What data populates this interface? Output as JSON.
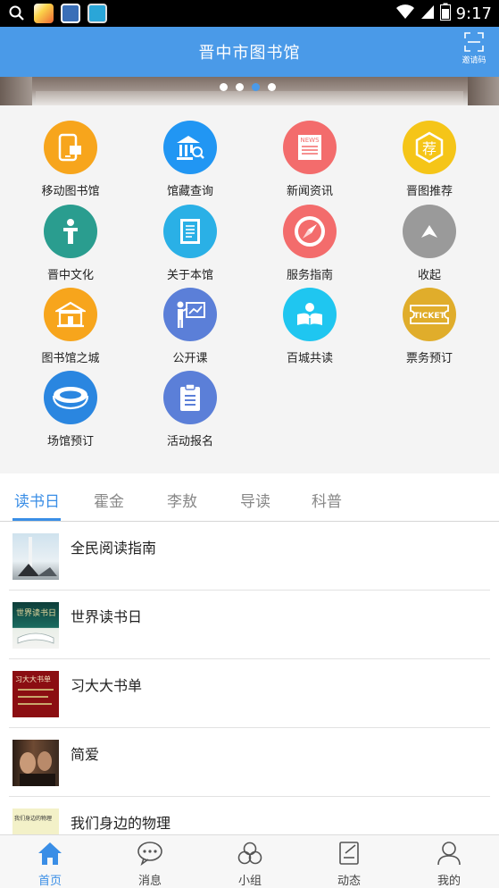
{
  "statusbar": {
    "time": "9:17"
  },
  "header": {
    "title": "晋中市图书馆",
    "invite_label": "邀请码"
  },
  "banner": {
    "slide_count": 4,
    "active_index": 2
  },
  "grid": [
    {
      "label": "移动图书馆",
      "icon": "mobile-library-icon",
      "color": "#f7a51c"
    },
    {
      "label": "馆藏查询",
      "icon": "collection-search-icon",
      "color": "#2196f3"
    },
    {
      "label": "新闻资讯",
      "icon": "news-icon",
      "color": "#f36c6c"
    },
    {
      "label": "晋图推荐",
      "icon": "recommend-icon",
      "color": "#f5c518"
    },
    {
      "label": "晋中文化",
      "icon": "culture-icon",
      "color": "#2a9d8f"
    },
    {
      "label": "关于本馆",
      "icon": "about-icon",
      "color": "#2ab0e6"
    },
    {
      "label": "服务指南",
      "icon": "compass-icon",
      "color": "#f36c6c"
    },
    {
      "label": "收起",
      "icon": "collapse-icon",
      "color": "#9a9a9a"
    },
    {
      "label": "图书馆之城",
      "icon": "library-city-icon",
      "color": "#f7a51c"
    },
    {
      "label": "公开课",
      "icon": "open-course-icon",
      "color": "#5b7fd8"
    },
    {
      "label": "百城共读",
      "icon": "reading-icon",
      "color": "#1fc6f0"
    },
    {
      "label": "票务预订",
      "icon": "ticket-icon",
      "color": "#e0ad2b"
    },
    {
      "label": "场馆预订",
      "icon": "venue-icon",
      "color": "#2a86e0"
    },
    {
      "label": "活动报名",
      "icon": "signup-icon",
      "color": "#5b7fd8"
    }
  ],
  "ticket_text": "TICKET",
  "recommend_char": "荐",
  "news_text": "NEWS",
  "tabs": [
    "读书日",
    "霍金",
    "李敖",
    "导读",
    "科普"
  ],
  "active_tab": 0,
  "list": [
    {
      "title": "全民阅读指南"
    },
    {
      "title": "世界读书日",
      "thumb_text": "世界读书日"
    },
    {
      "title": "习大大书单",
      "thumb_text": "习大大书单"
    },
    {
      "title": "简爱"
    },
    {
      "title": "我们身边的物理",
      "thumb_text": "我们身边的物理"
    }
  ],
  "bottomnav": [
    {
      "label": "首页",
      "icon": "home-icon",
      "active": true
    },
    {
      "label": "消息",
      "icon": "message-icon",
      "active": false
    },
    {
      "label": "小组",
      "icon": "group-icon",
      "active": false
    },
    {
      "label": "动态",
      "icon": "feed-icon",
      "active": false
    },
    {
      "label": "我的",
      "icon": "profile-icon",
      "active": false
    }
  ],
  "colors": {
    "primary": "#4a9ae8",
    "tab_active": "#3a8ee6"
  }
}
